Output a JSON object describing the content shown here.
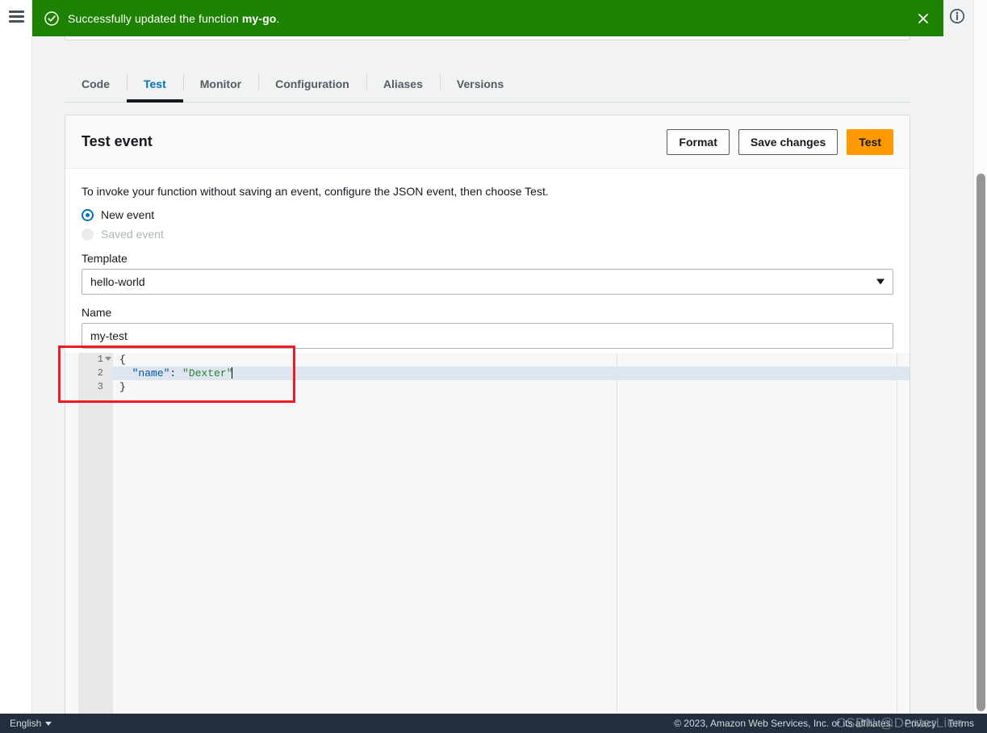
{
  "flash": {
    "icon": "check-circle-icon",
    "message_prefix": "Successfully updated the function ",
    "function_name": "my-go",
    "message_suffix": ".",
    "close_icon": "close-icon",
    "bg_color": "#1d8102"
  },
  "topbar": {
    "menu_icon": "hamburger-menu-icon",
    "info_icon": "info-circle-icon"
  },
  "tabs": [
    {
      "label": "Code",
      "active": false
    },
    {
      "label": "Test",
      "active": true
    },
    {
      "label": "Monitor",
      "active": false
    },
    {
      "label": "Configuration",
      "active": false
    },
    {
      "label": "Aliases",
      "active": false
    },
    {
      "label": "Versions",
      "active": false
    }
  ],
  "card": {
    "title": "Test event",
    "buttons": {
      "format": "Format",
      "save_changes": "Save changes",
      "test": "Test"
    },
    "accent_color": "#ff9900",
    "description": "To invoke your function without saving an event, configure the JSON event, then choose Test.",
    "event_source": {
      "new_event": {
        "label": "New event",
        "selected": true,
        "disabled": false
      },
      "saved_event": {
        "label": "Saved event",
        "selected": false,
        "disabled": true
      }
    },
    "template": {
      "label": "Template",
      "value": "hello-world",
      "caret_icon": "chevron-down-icon"
    },
    "name": {
      "label": "Name",
      "value": "my-test",
      "placeholder": ""
    }
  },
  "editor": {
    "lines": [
      {
        "num": "1",
        "fold": true,
        "indent": "",
        "tokens": [
          {
            "t": "punct",
            "v": "{"
          }
        ]
      },
      {
        "num": "2",
        "fold": false,
        "indent": "  ",
        "tokens": [
          {
            "t": "key",
            "v": "\"name\""
          },
          {
            "t": "punct",
            "v": ": "
          },
          {
            "t": "str",
            "v": "\"Dexter\""
          }
        ],
        "active": true,
        "cursor": true
      },
      {
        "num": "3",
        "fold": false,
        "indent": "",
        "tokens": [
          {
            "t": "punct",
            "v": "}"
          }
        ]
      }
    ],
    "colors": {
      "key": "#0451a5",
      "string": "#2e7d32",
      "punct": "#1c1c1c",
      "active_line": "#dde6ef"
    }
  },
  "annotation": {
    "type": "red-rectangle-highlight",
    "color": "#ee1b24"
  },
  "footer": {
    "language": "English",
    "language_caret": "chevron-down-icon",
    "copyright": "© 2023, Amazon Web Services, Inc. or its affiliates.",
    "privacy": "Privacy",
    "terms": "Terms",
    "watermark": "CSDN @DexterLien"
  },
  "scrollbar": {
    "name": "page-scrollbar"
  }
}
